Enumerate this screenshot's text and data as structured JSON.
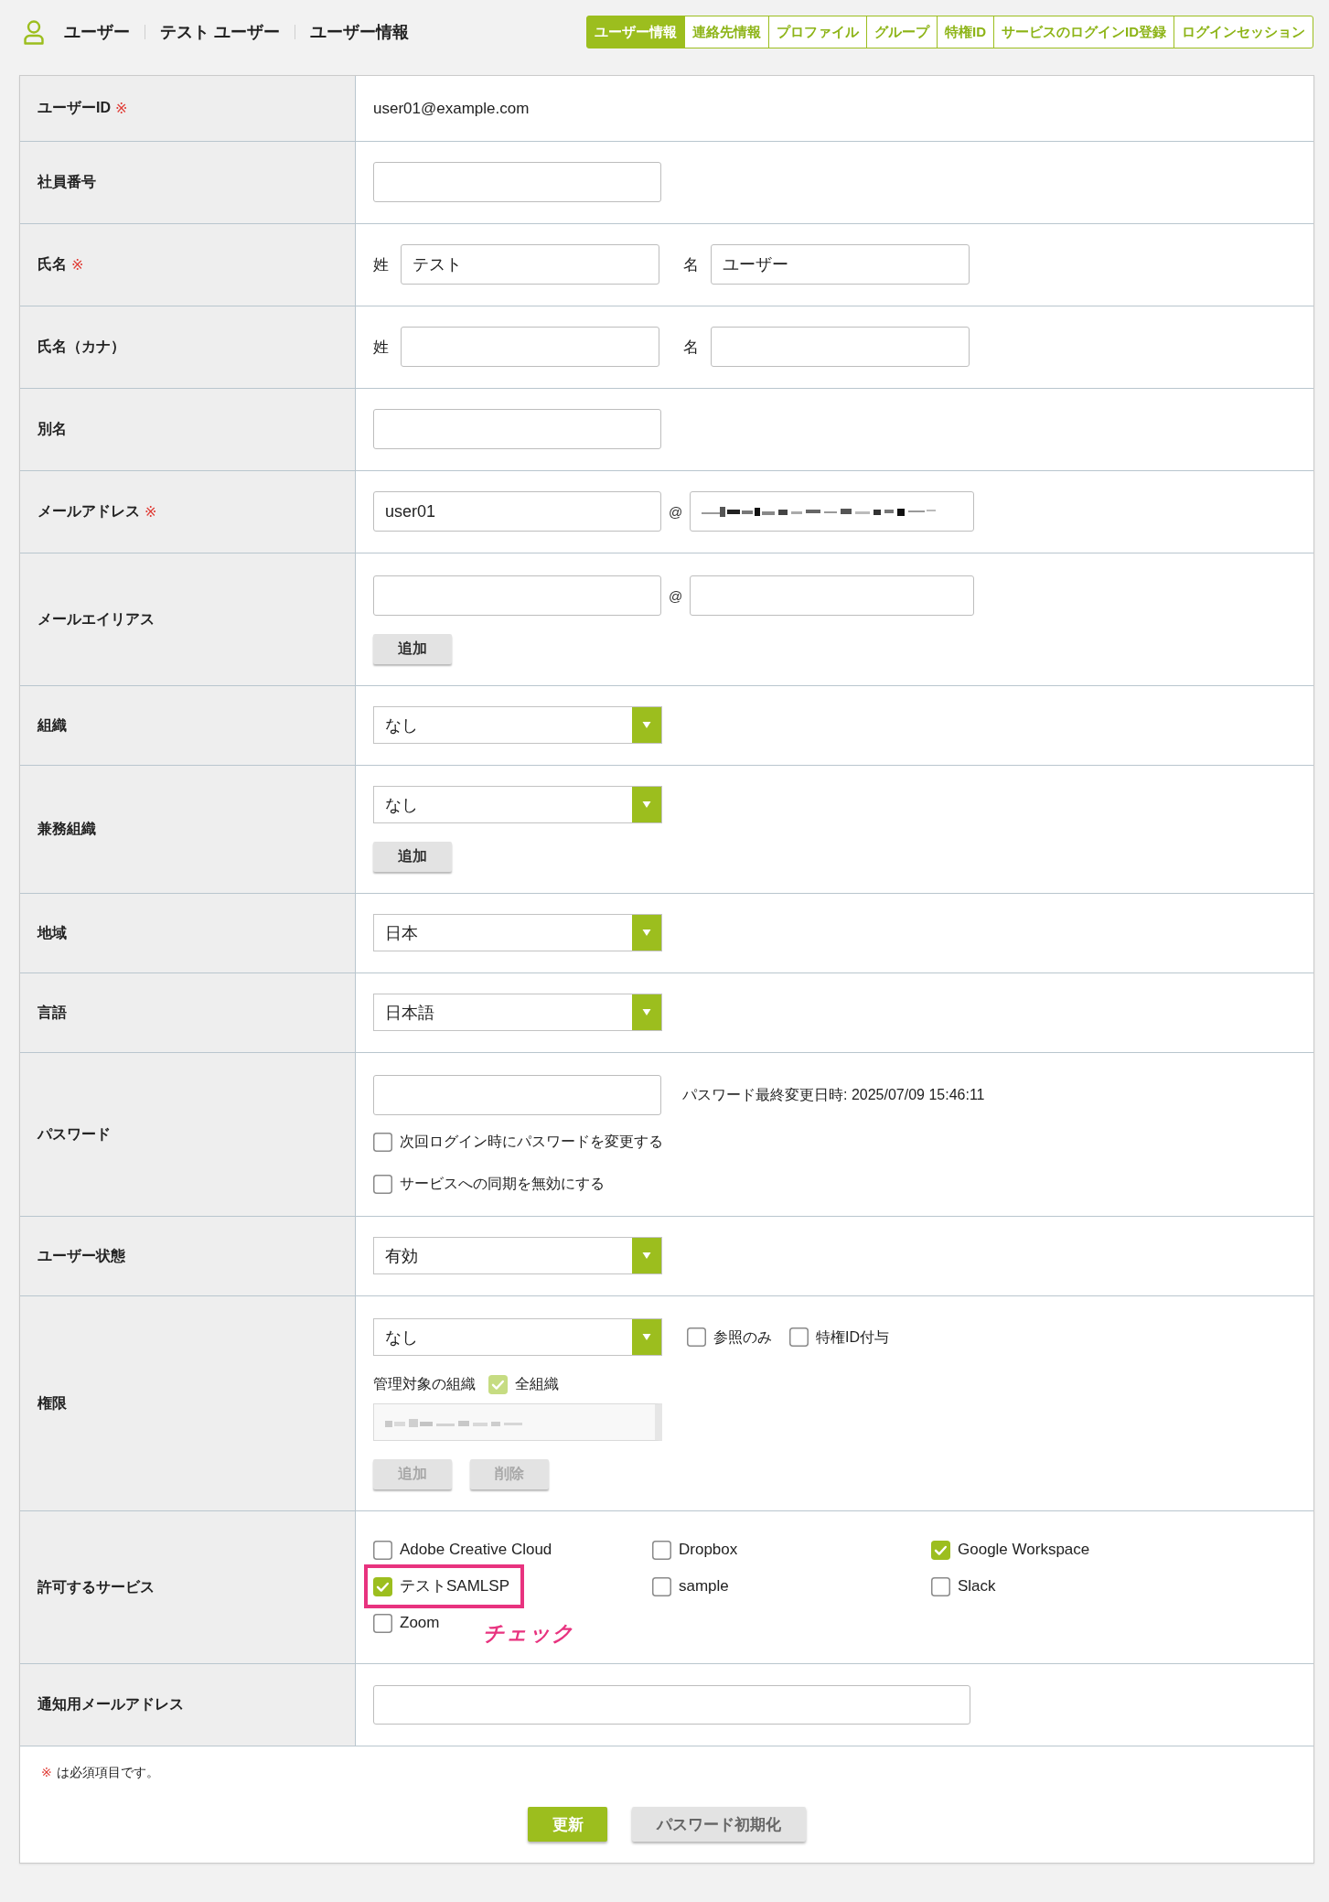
{
  "header": {
    "breadcrumbs": [
      "ユーザー",
      "テスト ユーザー",
      "ユーザー情報"
    ]
  },
  "tabs": [
    {
      "label": "ユーザー情報",
      "selected": true
    },
    {
      "label": "連絡先情報",
      "selected": false
    },
    {
      "label": "プロファイル",
      "selected": false
    },
    {
      "label": "グループ",
      "selected": false
    },
    {
      "label": "特権ID",
      "selected": false
    },
    {
      "label": "サービスのログインID登録",
      "selected": false
    },
    {
      "label": "ログインセッション",
      "selected": false
    }
  ],
  "form": {
    "rows": [
      {
        "kind": "static",
        "label": "ユーザーID",
        "mark": "※",
        "value": "user01@example.com"
      },
      {
        "kind": "input",
        "label": "社員番号"
      },
      {
        "kind": "name",
        "label": "氏名",
        "mark": "※",
        "parts": [
          {
            "prefix": "姓",
            "value": "テスト"
          },
          {
            "prefix": "名",
            "value": "ユーザー"
          }
        ]
      },
      {
        "kind": "name",
        "label": "氏名（カナ）",
        "parts": [
          {
            "prefix": "姓"
          },
          {
            "prefix": "名"
          }
        ]
      },
      {
        "kind": "input",
        "label": "別名"
      },
      {
        "kind": "email",
        "label": "メールアドレス",
        "mark": "※",
        "local": "user01",
        "at": "@",
        "domain_blurred": true
      },
      {
        "kind": "email",
        "label": "メールエイリアス",
        "at": "@",
        "button": {
          "label": "追加",
          "disabled": false
        }
      },
      {
        "kind": "select",
        "label": "組織",
        "value": "なし"
      },
      {
        "kind": "select",
        "label": "兼務組織",
        "value": "なし",
        "button": {
          "label": "追加",
          "disabled": false
        }
      },
      {
        "kind": "select",
        "label": "地域",
        "value": "日本"
      },
      {
        "kind": "select",
        "label": "言語",
        "value": "日本語"
      },
      {
        "kind": "password",
        "label": "パスワード",
        "note": "パスワード最終変更日時: 2025/07/09 15:46:11",
        "options": [
          {
            "label": "次回ログイン時にパスワードを変更する",
            "checked": false
          },
          {
            "label": "サービスへの同期を無効にする",
            "checked": false
          }
        ]
      },
      {
        "kind": "select",
        "label": "ユーザー状態",
        "value": "有効"
      },
      {
        "kind": "permission",
        "label": "権限",
        "value": "なし",
        "flags": [
          {
            "label": "参照のみ",
            "checked": false
          },
          {
            "label": "特権ID付与",
            "checked": false
          }
        ],
        "scope_label": "管理対象の組織",
        "scope_all": {
          "label": "全組織",
          "checked": true,
          "disabled": true
        },
        "list_blurred": true,
        "buttons": [
          {
            "label": "追加",
            "disabled": true
          },
          {
            "label": "削除",
            "disabled": true
          }
        ]
      },
      {
        "kind": "services",
        "label": "許可するサービス",
        "services": [
          {
            "label": "Adobe Creative Cloud",
            "checked": false,
            "highlighted": false
          },
          {
            "label": "Dropbox",
            "checked": false,
            "highlighted": false
          },
          {
            "label": "Google Workspace",
            "checked": true,
            "highlighted": false
          },
          {
            "label": "テストSAMLSP",
            "checked": true,
            "highlighted": true
          },
          {
            "label": "sample",
            "checked": false,
            "highlighted": false
          },
          {
            "label": "Slack",
            "checked": false,
            "highlighted": false
          },
          {
            "label": "Zoom",
            "checked": false,
            "highlighted": false
          }
        ],
        "annotation": "チェック"
      },
      {
        "kind": "wide_input",
        "label": "通知用メールアドレス"
      }
    ]
  },
  "footer": {
    "note": {
      "mark": "※",
      "text": "は必須項目です。"
    },
    "buttons": [
      {
        "label": "更新",
        "kind": "primary"
      },
      {
        "label": "パスワード初期化",
        "kind": "secondary"
      }
    ]
  }
}
